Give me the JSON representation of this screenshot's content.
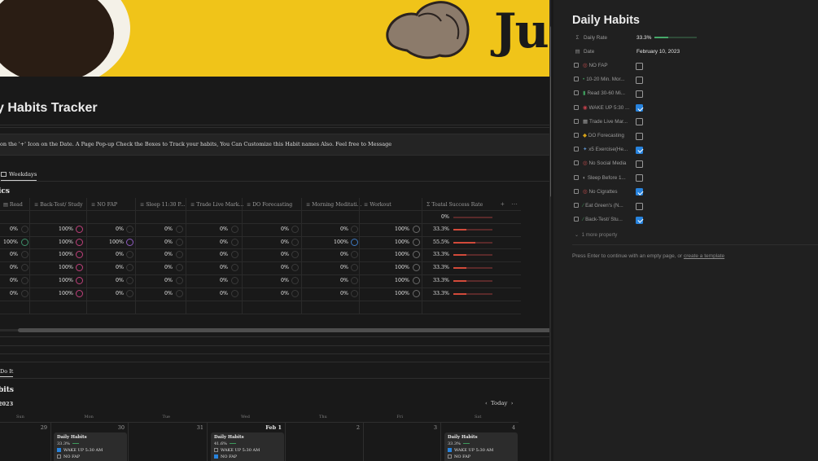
{
  "cover": {
    "text": "Ju"
  },
  "page": {
    "title": "y Habits Tracker",
    "callout": "on the '+' Icon on the Date. A Page Pop-up Check the Boxes to Track your habits, You Can Customize this Habit names Also. Feel free to Message",
    "view_tab": "Weekdays",
    "section_heading": "ics"
  },
  "table": {
    "columns": [
      {
        "icon": "▤",
        "label": "Read"
      },
      {
        "icon": "≡",
        "label": "Back-Test/ Study"
      },
      {
        "icon": "≡",
        "label": "NO FAP"
      },
      {
        "icon": "≡",
        "label": "Sleep 11:30 P..."
      },
      {
        "icon": "≡",
        "label": "Trade Live Mark..."
      },
      {
        "icon": "≡",
        "label": "DO Forecasting"
      },
      {
        "icon": "≡",
        "label": "Morning Meditati..."
      },
      {
        "icon": "≡",
        "label": "Workout"
      },
      {
        "icon": "Σ",
        "label": "Toatal Success Rate"
      }
    ],
    "summary_row": {
      "total": "0%"
    },
    "rows": [
      {
        "cells": [
          "0%",
          "100%",
          "0%",
          "0%",
          "0%",
          "0%",
          "0%",
          "100%"
        ],
        "total": "33.3%",
        "total_value": 0.333
      },
      {
        "cells": [
          "100%",
          "100%",
          "100%",
          "0%",
          "0%",
          "0%",
          "100%",
          "100%"
        ],
        "total": "55.5%",
        "total_value": 0.555
      },
      {
        "cells": [
          "0%",
          "100%",
          "0%",
          "0%",
          "0%",
          "0%",
          "0%",
          "100%"
        ],
        "total": "33.3%",
        "total_value": 0.333
      },
      {
        "cells": [
          "0%",
          "100%",
          "0%",
          "0%",
          "0%",
          "0%",
          "0%",
          "100%"
        ],
        "total": "33.3%",
        "total_value": 0.333
      },
      {
        "cells": [
          "0%",
          "100%",
          "0%",
          "0%",
          "0%",
          "0%",
          "0%",
          "100%"
        ],
        "total": "33.3%",
        "total_value": 0.333
      },
      {
        "cells": [
          "0%",
          "100%",
          "0%",
          "0%",
          "0%",
          "0%",
          "0%",
          "100%"
        ],
        "total": "33.3%",
        "total_value": 0.333
      }
    ]
  },
  "calendar": {
    "view_tab": "Do It",
    "heading": "bits",
    "year_label": "2023",
    "today_label": "Today",
    "weekdays": [
      "Sun",
      "Mon",
      "Tue",
      "Wed",
      "Thu",
      "Fri",
      "Sat"
    ],
    "dates": [
      "29",
      "30",
      "31",
      "Feb 1",
      "2",
      "3",
      "4"
    ],
    "cards": [
      {
        "title": "Daily Habits",
        "rate": "33.3%",
        "items": [
          {
            "label": "WAKE UP 5:30 AM",
            "checked": true
          },
          {
            "label": "NO FAP",
            "checked": false
          }
        ]
      },
      {
        "title": "Daily Habits",
        "rate": "41.6%",
        "items": [
          {
            "label": "WAKE UP 5:30 AM",
            "checked": false
          },
          {
            "label": "NO FAP",
            "checked": true
          }
        ]
      },
      {
        "title": "Daily Habits",
        "rate": "33.3%",
        "items": [
          {
            "label": "WAKE UP 5:30 AM",
            "checked": true
          },
          {
            "label": "NO FAP",
            "checked": false
          }
        ]
      }
    ]
  },
  "panel": {
    "title": "Daily Habits",
    "daily_rate_label": "Daily Rate",
    "daily_rate_value": "33.3%",
    "daily_rate_fraction": 0.333,
    "date_label": "Date",
    "date_value": "February 10, 2023",
    "habits": [
      {
        "icon": "◎",
        "label": "NO FAP",
        "checked": false
      },
      {
        "icon": "•",
        "label": "10-20 Min. Mor...",
        "checked": false
      },
      {
        "icon": "▮",
        "label": "Read 30-60 Mi...",
        "checked": false
      },
      {
        "icon": "◉",
        "label": "WAKE UP 5:30 ...",
        "checked": true
      },
      {
        "icon": "▦",
        "label": "Trade Live Mar...",
        "checked": false
      },
      {
        "icon": "◆",
        "label": "DO Forecasting",
        "checked": false
      },
      {
        "icon": "✦",
        "label": "x5 Exercise(He...",
        "checked": true
      },
      {
        "icon": "◎",
        "label": "No Social Media",
        "checked": false
      },
      {
        "icon": "◐",
        "label": "Sleep Before 1...",
        "checked": false
      },
      {
        "icon": "◎",
        "label": "No Cigrattes",
        "checked": true
      },
      {
        "icon": "∕",
        "label": "Eat Green's (N...",
        "checked": false
      },
      {
        "icon": "∕",
        "label": "Back-Test/ Stu...",
        "checked": true
      }
    ],
    "more_label": "1 more property",
    "hint_prefix": "Press Enter to continue with an empty page, or ",
    "hint_link": "create a template"
  }
}
